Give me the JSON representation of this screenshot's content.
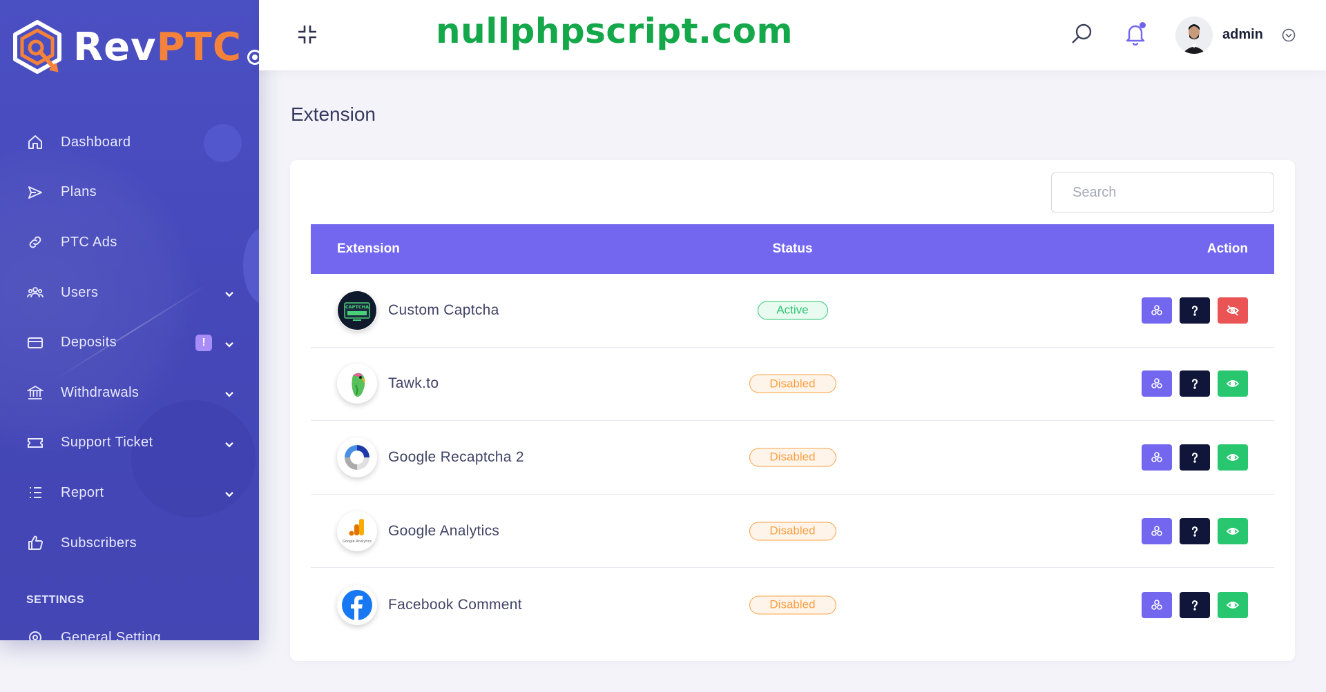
{
  "brand": {
    "part1": "Rev",
    "part2": "PTC"
  },
  "topbar": {
    "site_text": "nullphpscript.com",
    "user_name": "admin"
  },
  "sidebar": {
    "items": [
      {
        "label": "Dashboard",
        "icon": "home-icon"
      },
      {
        "label": "Plans",
        "icon": "paper-plane-icon"
      },
      {
        "label": "PTC Ads",
        "icon": "link-icon"
      },
      {
        "label": "Users",
        "icon": "users-icon",
        "has_children": true
      },
      {
        "label": "Deposits",
        "icon": "credit-card-icon",
        "has_children": true,
        "badge": "!"
      },
      {
        "label": "Withdrawals",
        "icon": "bank-icon",
        "has_children": true
      },
      {
        "label": "Support Ticket",
        "icon": "ticket-icon",
        "has_children": true
      },
      {
        "label": "Report",
        "icon": "list-icon",
        "has_children": true
      },
      {
        "label": "Subscribers",
        "icon": "thumbs-up-icon"
      }
    ],
    "settings_title": "SETTINGS",
    "general_setting": "General Setting"
  },
  "page": {
    "title": "Extension"
  },
  "search": {
    "placeholder": "Search"
  },
  "table": {
    "headers": {
      "extension": "Extension",
      "status": "Status",
      "action": "Action"
    },
    "rows": [
      {
        "name": "Custom Captcha",
        "status": "Active",
        "logo": "captcha-logo-icon",
        "logo_text": "CAPTCHA"
      },
      {
        "name": "Tawk.to",
        "status": "Disabled",
        "logo": "parrot-logo-icon"
      },
      {
        "name": "Google Recaptcha 2",
        "status": "Disabled",
        "logo": "recaptcha-logo-icon"
      },
      {
        "name": "Google Analytics",
        "status": "Disabled",
        "logo": "analytics-logo-icon",
        "logo_text": "Google Analytics"
      },
      {
        "name": "Facebook Comment",
        "status": "Disabled",
        "logo": "facebook-logo-icon"
      }
    ]
  },
  "colors": {
    "sidebar": "#4a4fc2",
    "primary": "#7367f0",
    "dark": "#10163a",
    "success": "#28c76f",
    "danger": "#ea5455",
    "warning": "#ff9f43",
    "brand_orange": "#f5823a",
    "site_text_green": "#14a84a"
  }
}
